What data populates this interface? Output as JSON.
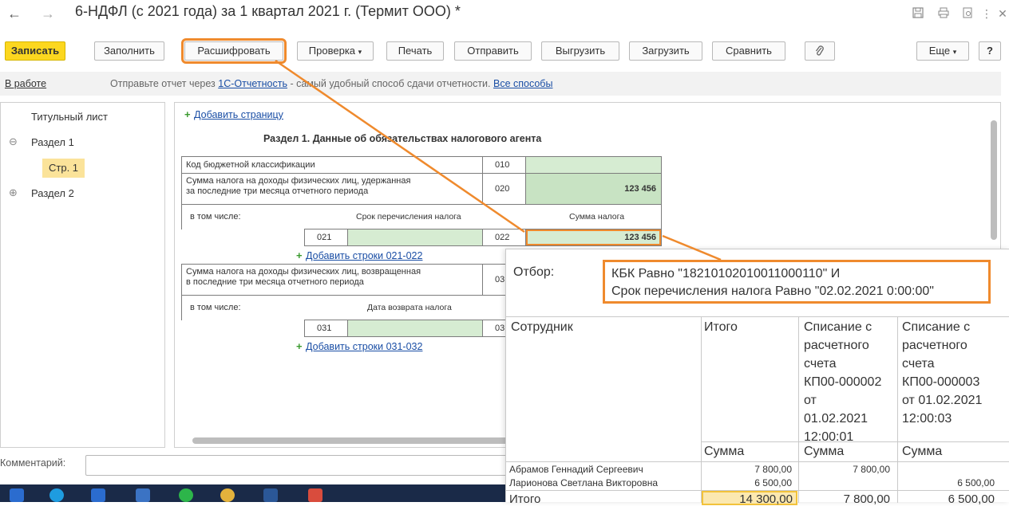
{
  "titlebar": {
    "back_icon": "←",
    "forward_icon": "→",
    "title": "6-НДФЛ (с 2021 года) за 1 квартал 2021 г. (Термит ООО) *",
    "icons": [
      "save-icon",
      "print-icon",
      "preview-icon",
      "more-icon",
      "close-icon"
    ]
  },
  "toolbar": {
    "write": "Записать",
    "fill": "Заполнить",
    "decode": "Расшифровать",
    "check": "Проверка",
    "print": "Печать",
    "send": "Отправить",
    "export": "Выгрузить",
    "import": "Загрузить",
    "compare": "Сравнить",
    "more": "Еще",
    "help": "?"
  },
  "infobar": {
    "status": "В работе",
    "text_before": "Отправьте отчет через ",
    "link1": "1С-Отчетность",
    "text_after": " - самый удобный способ сдачи отчетности. ",
    "link2": "Все способы"
  },
  "leftnav": {
    "items": [
      {
        "label": "Титульный лист"
      },
      {
        "label": "Раздел 1",
        "toggle": "⊖"
      },
      {
        "label": "Стр. 1"
      },
      {
        "label": "Раздел 2",
        "toggle": "⊕"
      }
    ]
  },
  "form": {
    "add_page": "Добавить страницу",
    "section_title": "Раздел 1. Данные об обязательствах налогового агента",
    "kbk_label": "Код бюджетной классификации",
    "kbk_code": "010",
    "withheld_label_1": "Сумма налога на доходы физических лиц, удержанная",
    "withheld_label_2": "за последние три месяца отчетного периода",
    "withheld_code": "020",
    "withheld_value": "123 456",
    "incl_label": "в том числе:",
    "term_label": "Срок перечисления налога",
    "sum_label": "Сумма налога",
    "code_021": "021",
    "code_022": "022",
    "value_022": "123 456",
    "add_rows_021": "Добавить строки 021-022",
    "returned_label_1": "Сумма налога на доходы физических лиц, возвращенная",
    "returned_label_2": "в последние три месяца отчетного периода",
    "returned_code": "03",
    "incl_label_2": "в том числе:",
    "return_date_label": "Дата возврата налога",
    "code_031": "031",
    "code_03x": "03",
    "add_rows_031": "Добавить строки 031-032"
  },
  "comment": {
    "label": "Комментарий:",
    "value": ""
  },
  "popup": {
    "filter_label": "Отбор:",
    "filter_line1": "КБК Равно \"18210102010011000110\" И",
    "filter_line2": "Срок перечисления налога Равно \"02.02.2021 0:00:00\"",
    "col_employee": "Сотрудник",
    "col_total": "Итого",
    "col_a_lines": [
      "Списание с",
      "расчетного",
      "счета",
      "КП00-000002",
      "от",
      "01.02.2021",
      "12:00:01"
    ],
    "col_b_lines": [
      "Списание с",
      "расчетного",
      "счета",
      "КП00-000003",
      "от 01.02.2021",
      "12:00:03"
    ],
    "sub_sum": "Сумма",
    "rows": [
      {
        "name": "Абрамов Геннадий Сергеевич",
        "total": "7 800,00",
        "a": "7 800,00",
        "b": ""
      },
      {
        "name": "Ларионова Светлана Викторовна",
        "total": "6 500,00",
        "a": "",
        "b": "6 500,00"
      }
    ],
    "total_row": {
      "name": "Итого",
      "total": "14 300,00",
      "a": "7 800,00",
      "b": "6 500,00"
    }
  },
  "colors": {
    "accent_orange": "#ef8a2d",
    "primary_yellow": "#fcd71f",
    "link_blue": "#1a4ea5",
    "cell_green": "#d6ecd2"
  }
}
